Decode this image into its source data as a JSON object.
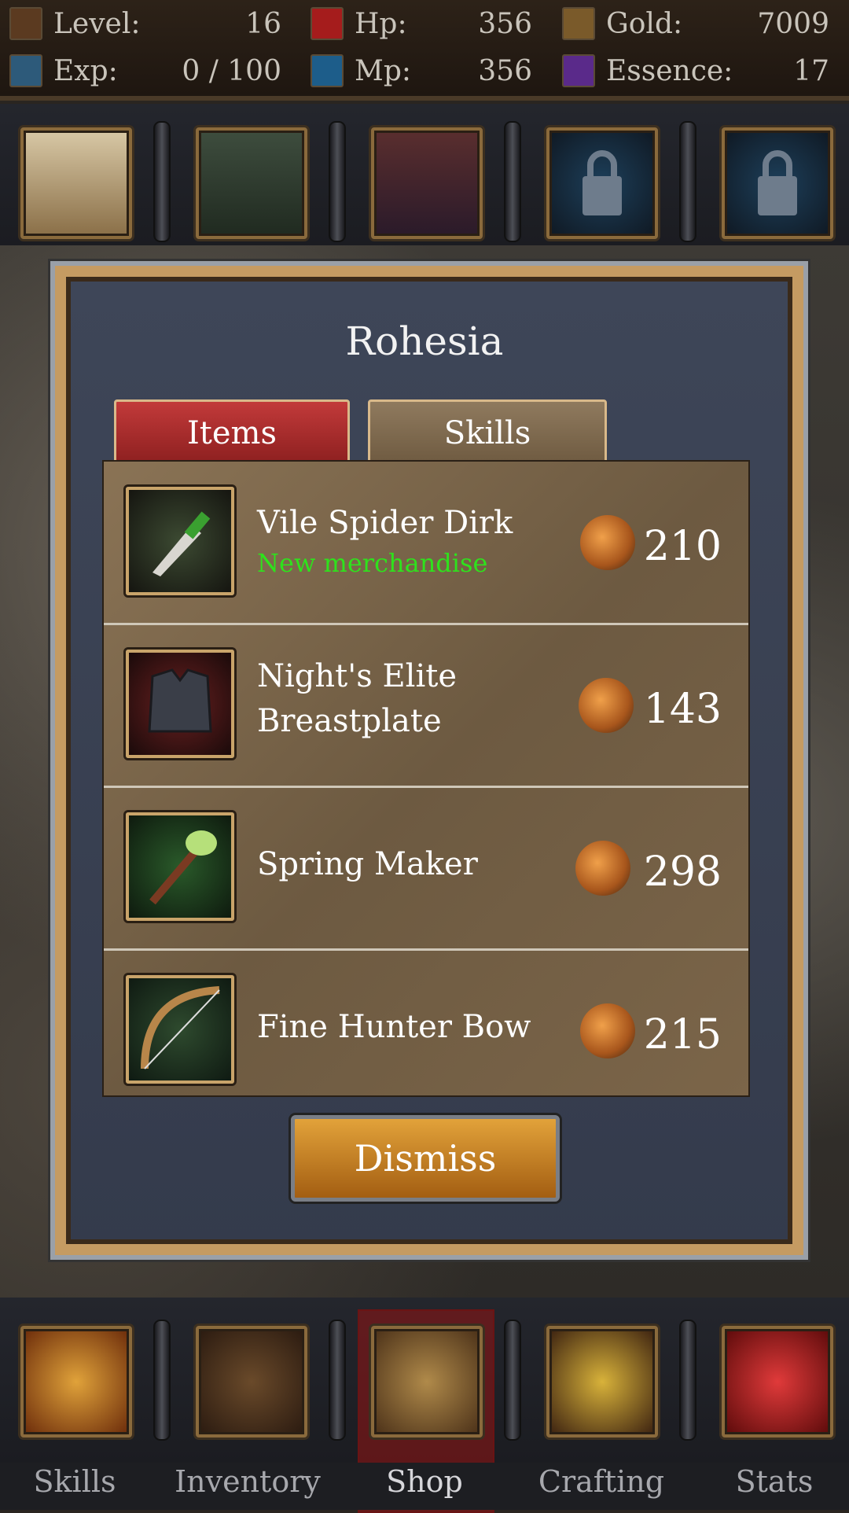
{
  "stats": {
    "level_label": "Level:",
    "level_value": "16",
    "hp_label": "Hp:",
    "hp_value": "356",
    "gold_label": "Gold:",
    "gold_value": "7009",
    "exp_label": "Exp:",
    "exp_value": "0 / 100",
    "mp_label": "Mp:",
    "mp_value": "356",
    "essence_label": "Essence:",
    "essence_value": "17"
  },
  "shop": {
    "title": "Rohesia",
    "tabs": [
      {
        "label": "Items"
      },
      {
        "label": "Skills"
      }
    ],
    "items": [
      {
        "name": "Vile Spider Dirk",
        "note": "New merchandise",
        "price": "210",
        "icon": "dagger-icon"
      },
      {
        "name": "Night's Elite",
        "name2": "Breastplate",
        "price": "143",
        "icon": "breastplate-icon"
      },
      {
        "name": "Spring Maker",
        "price": "298",
        "icon": "staff-icon"
      },
      {
        "name": "Fine Hunter Bow",
        "price": "215",
        "icon": "bow-icon"
      }
    ],
    "dismiss_label": "Dismiss"
  },
  "nav": {
    "tabs": [
      {
        "label": "Skills"
      },
      {
        "label": "Inventory"
      },
      {
        "label": "Shop"
      },
      {
        "label": "Crafting"
      },
      {
        "label": "Stats"
      }
    ]
  },
  "colors": {
    "accent_new": "#2ee21c",
    "dismiss_button": "#c6801f",
    "items_tab": "#a32a2a"
  }
}
